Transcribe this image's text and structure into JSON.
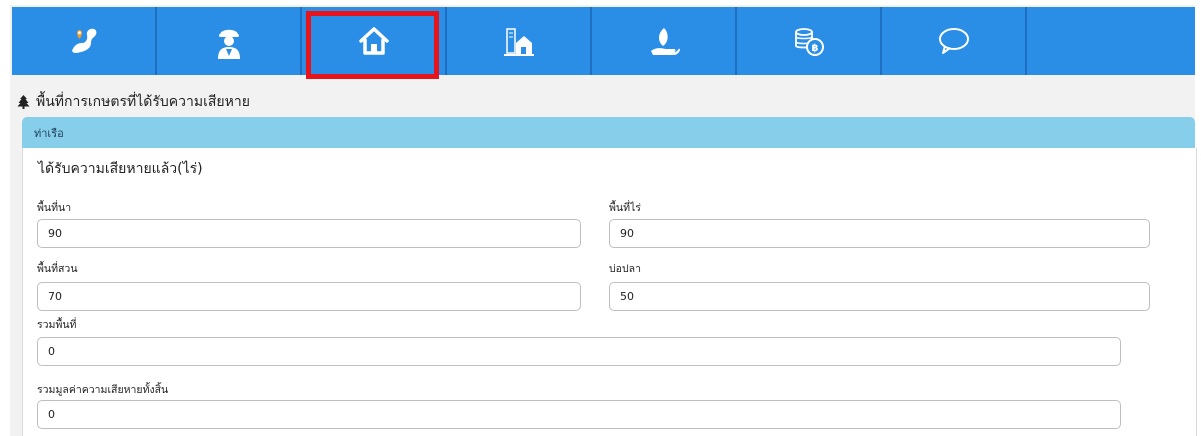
{
  "nav": {
    "items": [
      {
        "icon": "map-pin-icon"
      },
      {
        "icon": "worker-icon"
      },
      {
        "icon": "home-icon",
        "selected": true
      },
      {
        "icon": "city-buildings-icon"
      },
      {
        "icon": "hand-leaf-icon"
      },
      {
        "icon": "coins-icon"
      },
      {
        "icon": "chat-bubble-icon"
      }
    ],
    "selected_border_color": "#e8141b",
    "background_color": "#2a8ee6"
  },
  "section": {
    "title": "พื้นที่การเกษตรที่ได้รับความเสียหาย",
    "icon": "tree-icon"
  },
  "district": {
    "label": "ท่าเรือ",
    "background_color": "#87ceeb"
  },
  "form": {
    "title": "ได้รับความเสียหายแล้ว(ไร่)",
    "fields": {
      "rice_field": {
        "label": "พื้นที่นา",
        "value": "90"
      },
      "field_crop": {
        "label": "พื้นที่ไร่",
        "value": "90"
      },
      "orchard": {
        "label": "พื้นที่สวน",
        "value": "70"
      },
      "fish_pond": {
        "label": "บ่อปลา",
        "value": "50"
      },
      "total_area": {
        "label": "รวมพื้นที่",
        "value": "0"
      },
      "total_damage_value": {
        "label": "รวมมูลค่าความเสียหายทั้งสิ้น",
        "value": "0"
      }
    }
  }
}
